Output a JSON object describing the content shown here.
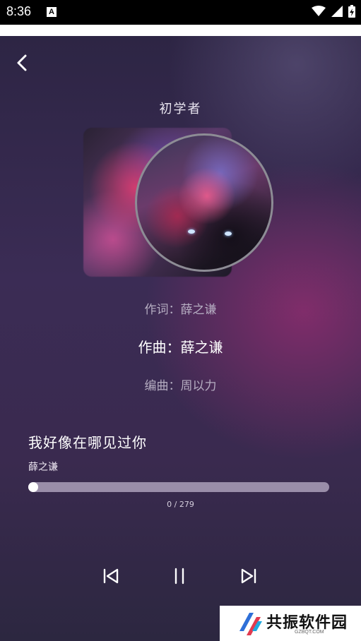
{
  "status_bar": {
    "time": "8:36",
    "notification_badge": "A",
    "icons": [
      "wifi-icon",
      "signal-icon",
      "battery-charging-icon"
    ]
  },
  "header": {
    "back_icon": "chevron-left-icon",
    "title": "初学者"
  },
  "credits": {
    "lyricist": "作词：薛之谦",
    "composer": "作曲：薛之谦",
    "arranger": "编曲：周以力"
  },
  "song": {
    "title": "我好像在哪见过你",
    "artist": "薛之谦"
  },
  "progress": {
    "time_display": "0 / 279",
    "fraction": 0
  },
  "controls": {
    "previous_icon": "skip-previous-icon",
    "pause_icon": "pause-icon",
    "next_icon": "skip-next-icon"
  },
  "watermark": {
    "title": "共振软件园",
    "subtitle": "GZBQT.COM"
  },
  "colors": {
    "accent": "#ffffff",
    "progress_track": "#9a8ea9",
    "background_dark": "#2f2840",
    "background_glow": "#8c2d6e"
  }
}
